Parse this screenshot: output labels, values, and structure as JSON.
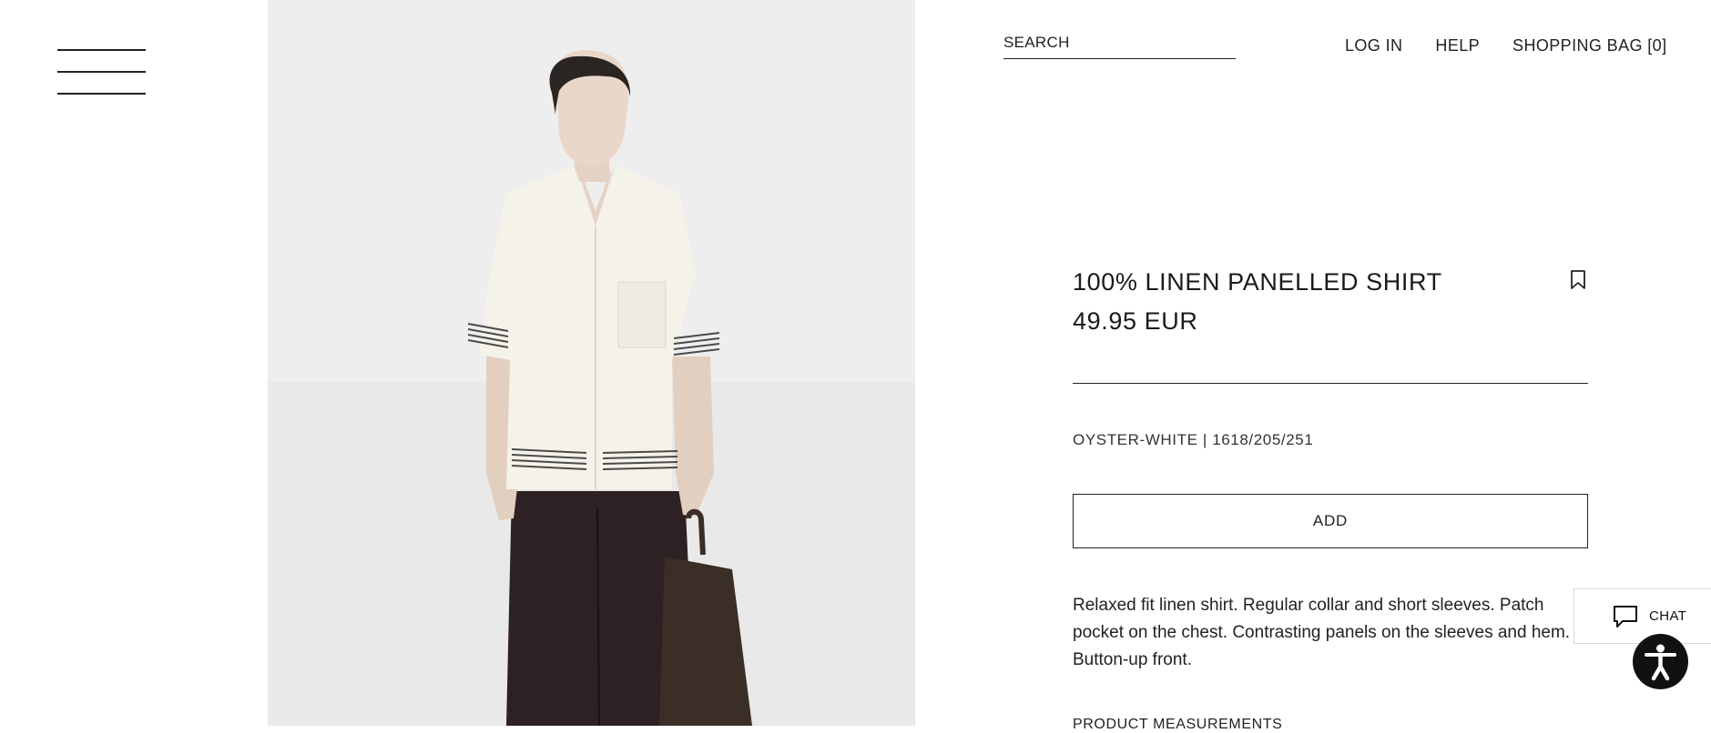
{
  "header": {
    "menu_icon": "hamburger-menu-icon",
    "search": {
      "placeholder": "SEARCH",
      "value": ""
    },
    "nav": [
      {
        "label": "LOG IN"
      },
      {
        "label": "HELP"
      },
      {
        "label": "SHOPPING BAG [0]"
      }
    ]
  },
  "product": {
    "name": "100% LINEN PANELLED SHIRT",
    "price": "49.95 EUR",
    "bookmark_icon": "bookmark-icon",
    "color_reference": "OYSTER-WHITE | 1618/205/251",
    "add_button": "ADD",
    "description": "Relaxed fit linen shirt. Regular collar and short sleeves. Patch pocket on the chest. Contrasting panels on the sleeves and hem. Button-up front.",
    "measurements_link": "PRODUCT MEASUREMENTS"
  },
  "widgets": {
    "chat_label": "CHAT",
    "chat_icon": "chat-bubble-icon",
    "accessibility_icon": "accessibility-person-icon"
  },
  "colors": {
    "text": "#1a1a1a",
    "photo_background": "#eeeeee",
    "shirt": "#f5f2e9",
    "trousers": "#2e2124",
    "bag": "#3a2e26",
    "stripe": "#4a4a4a"
  }
}
